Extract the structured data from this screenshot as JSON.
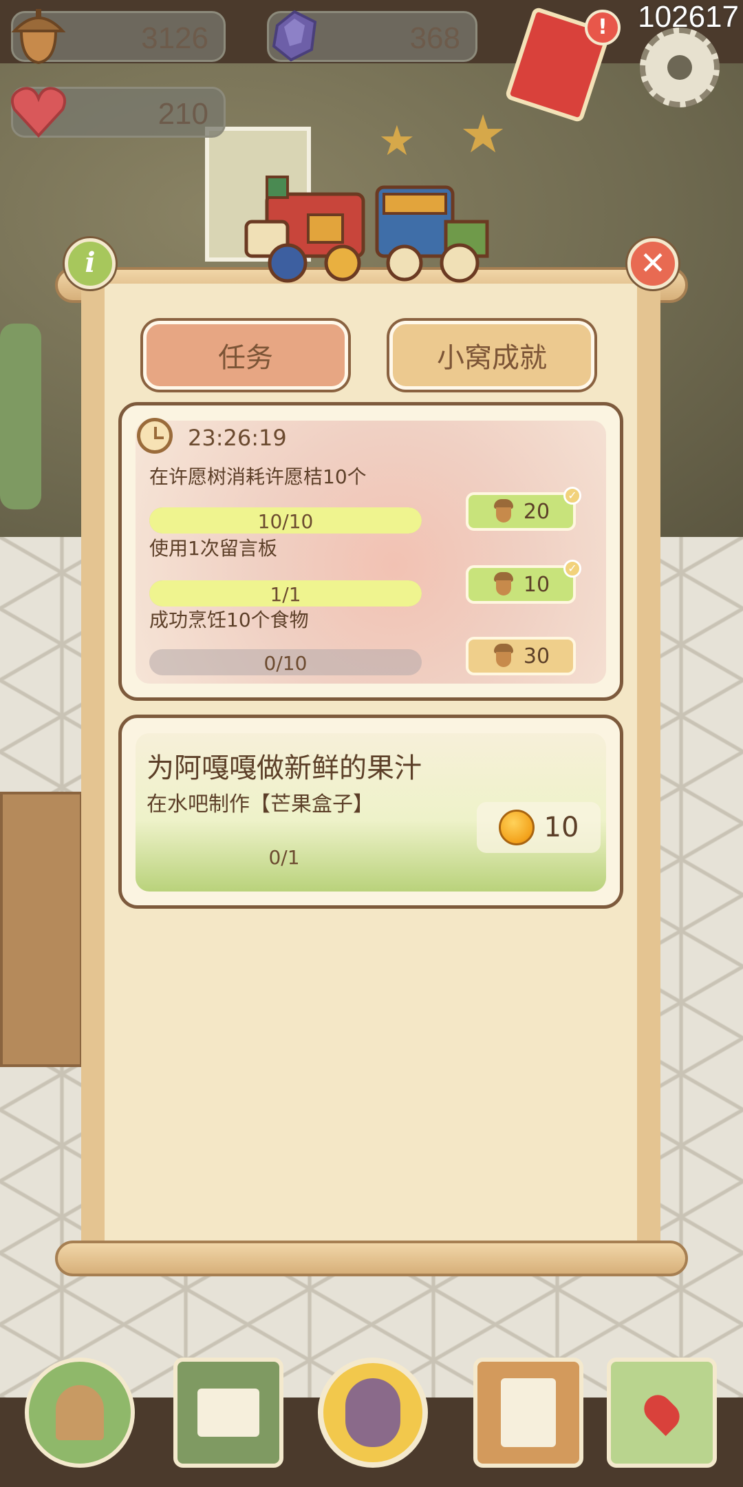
{
  "overlay_id": "102617",
  "resources": {
    "acorns": "3126",
    "gems": "368",
    "hearts": "210"
  },
  "tabs": {
    "active": "任务",
    "inactive": "小窝成就"
  },
  "daily_tasks": {
    "timer": "23:26:19",
    "tasks": [
      {
        "label": "在许愿树消耗许愿桔10个",
        "progress": "10/10",
        "ratio": 1.0,
        "reward": "20",
        "completed": true
      },
      {
        "label": "使用1次留言板",
        "progress": "1/1",
        "ratio": 1.0,
        "reward": "10",
        "completed": true
      },
      {
        "label": "成功烹饪10个食物",
        "progress": "0/10",
        "ratio": 0.0,
        "reward": "30",
        "completed": false
      }
    ]
  },
  "quest": {
    "title": "为阿嘎嘎做新鲜的果汁",
    "description": "在水吧制作【芒果盒子】",
    "progress": "0/1",
    "reward": "10"
  },
  "colors": {
    "tab_active": "#e7a683",
    "tab_inactive": "#ecc98f",
    "progress_fill": "#eff48f",
    "reward_done": "#c8e37b",
    "reward_todo": "#efcf8b"
  },
  "icons": [
    "acorn-icon",
    "gem-icon",
    "heart-icon",
    "settings-gear-icon",
    "info-icon",
    "close-icon",
    "clock-icon",
    "bell-icon",
    "check-icon"
  ]
}
